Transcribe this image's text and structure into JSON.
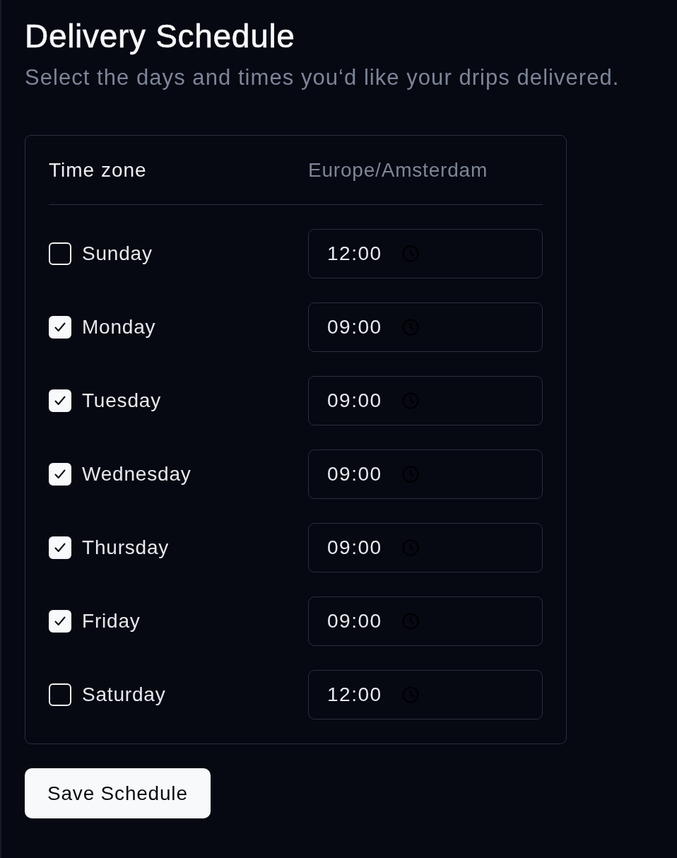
{
  "header": {
    "title": "Delivery Schedule",
    "subtitle": "Select the days and times you‘d like your drips delivered."
  },
  "schedule": {
    "timezone": {
      "label": "Time zone",
      "value": "Europe/Amsterdam"
    },
    "days": [
      {
        "name": "Sunday",
        "checked": false,
        "time": "12:00"
      },
      {
        "name": "Monday",
        "checked": true,
        "time": "09:00"
      },
      {
        "name": "Tuesday",
        "checked": true,
        "time": "09:00"
      },
      {
        "name": "Wednesday",
        "checked": true,
        "time": "09:00"
      },
      {
        "name": "Thursday",
        "checked": true,
        "time": "09:00"
      },
      {
        "name": "Friday",
        "checked": true,
        "time": "09:00"
      },
      {
        "name": "Saturday",
        "checked": false,
        "time": "12:00"
      }
    ]
  },
  "save_button": {
    "label": "Save Schedule"
  }
}
